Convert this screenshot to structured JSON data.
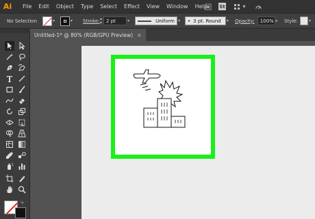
{
  "app": {
    "logo": "Ai"
  },
  "menu": [
    "File",
    "Edit",
    "Object",
    "Type",
    "Select",
    "Effect",
    "View",
    "Window",
    "Help"
  ],
  "menubar_right": {
    "st_label": "St"
  },
  "control_bar": {
    "selection_label": "No Selection",
    "stroke_label": "Stroke:",
    "stroke_value": "2 pt",
    "profile_value": "Uniform",
    "brush_value": "3 pt. Round",
    "opacity_label": "Opacity:",
    "opacity_value": "100%",
    "style_label": "Style:"
  },
  "document_tab": {
    "title": "Untitled-1* @ 80% (RGB/GPU Preview)",
    "close": "×"
  },
  "colors": {
    "menubar_bg": "#323232",
    "panel_bg": "#3c3c3c",
    "canvas_bg": "#535353",
    "artboard_bg": "#ececec",
    "frame_border": "#19f019",
    "logo": "#ff9a00"
  },
  "tools": [
    "selection-tool",
    "direct-selection-tool",
    "magic-wand-tool",
    "lasso-tool",
    "pen-tool",
    "curvature-tool",
    "type-tool",
    "line-segment-tool",
    "rectangle-tool",
    "paintbrush-tool",
    "shaper-tool",
    "eraser-tool",
    "rotate-tool",
    "scale-tool",
    "width-tool",
    "free-transform-tool",
    "shape-builder-tool",
    "perspective-grid-tool",
    "mesh-tool",
    "gradient-tool",
    "eyedropper-tool",
    "blend-tool",
    "symbol-sprayer-tool",
    "column-graph-tool",
    "artboard-tool",
    "slice-tool",
    "hand-tool",
    "zoom-tool"
  ],
  "artwork": {
    "description_icon": "airplane-explosion-city-icon"
  }
}
